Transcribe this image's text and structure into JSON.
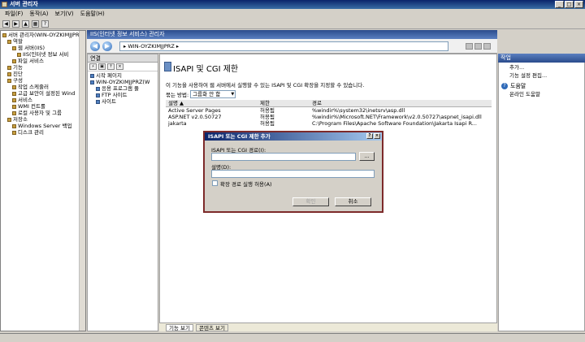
{
  "window": {
    "title": "서버 관리자"
  },
  "menu": [
    "파일(F)",
    "동작(A)",
    "보기(V)",
    "도움말(H)"
  ],
  "tree": {
    "items": [
      {
        "label": "서버 관리자(WIN-OYZKIMJJPR",
        "indent": 0
      },
      {
        "label": "역할",
        "indent": 1
      },
      {
        "label": "웹 서버(IIS)",
        "indent": 2
      },
      {
        "label": "IIS(인터넷 정보 서비",
        "indent": 3
      },
      {
        "label": "파일 서비스",
        "indent": 2
      },
      {
        "label": "기능",
        "indent": 1
      },
      {
        "label": "진단",
        "indent": 1
      },
      {
        "label": "구성",
        "indent": 1
      },
      {
        "label": "작업 스케줄러",
        "indent": 2
      },
      {
        "label": "고급 보안이 설정된 Wind",
        "indent": 2
      },
      {
        "label": "서비스",
        "indent": 2
      },
      {
        "label": "WMI 컨트롤",
        "indent": 2
      },
      {
        "label": "로컬 사용자 및 그룹",
        "indent": 2
      },
      {
        "label": "저장소",
        "indent": 1
      },
      {
        "label": "Windows Server 백업",
        "indent": 2
      },
      {
        "label": "디스크 관리",
        "indent": 2
      }
    ]
  },
  "iis": {
    "header": "IIS(인터넷 정보 서비스) 관리자",
    "address": "WIN-OYZKIMJJPRZ",
    "address_sep": "▸"
  },
  "connections": {
    "header": "연결",
    "items": [
      {
        "label": "시작 페이지",
        "indent": 0
      },
      {
        "label": "WIN-OYZKIMJJPRZ(W",
        "indent": 0
      },
      {
        "label": "응용 프로그램 풀",
        "indent": 1
      },
      {
        "label": "FTP 사이트",
        "indent": 1
      },
      {
        "label": "사이트",
        "indent": 1
      }
    ]
  },
  "main": {
    "title": "ISAPI 및 CGI 제한",
    "description": "이 기능을 사용하여 웹 서버에서 실행할 수 있는 ISAPI 및 CGI 확장을 지정할 수 있습니다.",
    "groupby_label": "묶는 방법:",
    "groupby_value": "그룹화 안 함",
    "columns": [
      "설명 ▲",
      "제한",
      "경로"
    ],
    "rows": [
      [
        "Active Server Pages",
        "허용됨",
        "%windir%\\system32\\inetsrv\\asp.dll"
      ],
      [
        "ASP.NET v2.0.50727",
        "허용됨",
        "%windir%\\Microsoft.NET\\Framework\\v2.0.50727\\aspnet_isapi.dll"
      ],
      [
        "jakarta",
        "허용됨",
        "C:\\Program Files\\Apache Software Foundation\\Jakarta Isapi R..."
      ]
    ]
  },
  "bottom_tabs": [
    "기능 보기",
    "콘텐츠 보기"
  ],
  "actions": {
    "header": "작업",
    "items": [
      "추가...",
      "기능 설정 편집..."
    ],
    "help": [
      "도움말",
      "온라인 도움말"
    ]
  },
  "dialog": {
    "title": "ISAPI 또는 CGI 제한 추가",
    "path_label": "ISAPI 또는 CGI 경로(I):",
    "path_value": "",
    "browse_label": "...",
    "desc_label": "설명(D):",
    "desc_value": "",
    "checkbox_label": "확장 경로 실행 허용(A)",
    "ok_label": "확인",
    "cancel_label": "취소"
  }
}
